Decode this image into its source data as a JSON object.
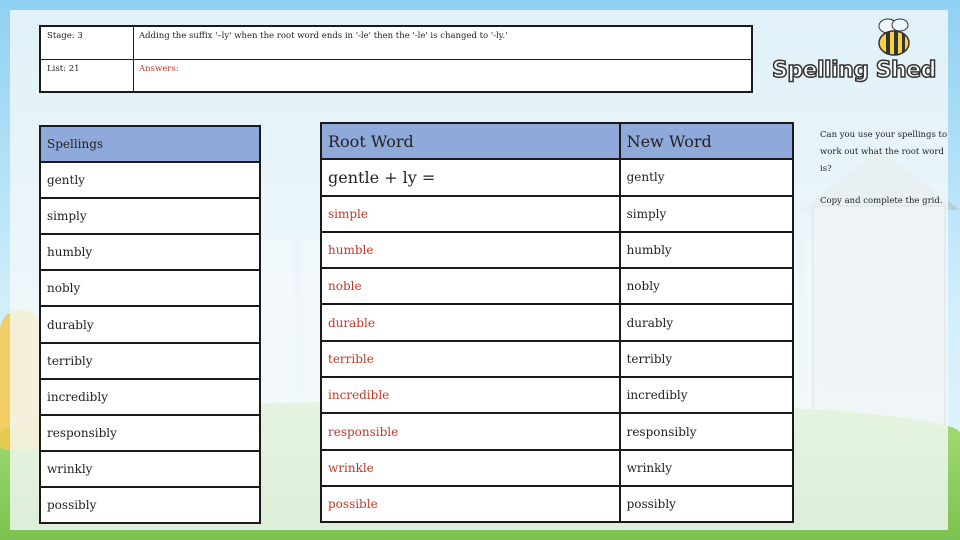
{
  "header": {
    "stage_label": "Stage: 3",
    "list_label": "List: 21",
    "rule_text": "Adding the suffix '–ly' when the root word ends in '-le' then the '-le' is changed to '-ly.'",
    "answers_label": "Answers:"
  },
  "logo": {
    "text": "Spelling Shed"
  },
  "sidebar": {
    "note1": "Can you use your spellings to work out what the root word is?",
    "note2": "Copy and complete the grid."
  },
  "spellings": {
    "header": "Spellings",
    "items": [
      "gently",
      "simply",
      "humbly",
      "nobly",
      "durably",
      "terribly",
      "incredibly",
      "responsibly",
      "wrinkly",
      "possibly"
    ]
  },
  "grid": {
    "root_header": "Root Word",
    "new_header": "New Word",
    "rows": [
      {
        "root": "gentle + ly =",
        "new": "gently"
      },
      {
        "root": "simple",
        "new": "simply"
      },
      {
        "root": "humble",
        "new": "humbly"
      },
      {
        "root": "noble",
        "new": "nobly"
      },
      {
        "root": "durable",
        "new": "durably"
      },
      {
        "root": "terrible",
        "new": "terribly"
      },
      {
        "root": "incredible",
        "new": "incredibly"
      },
      {
        "root": "responsible",
        "new": "responsibly"
      },
      {
        "root": "wrinkle",
        "new": "wrinkly"
      },
      {
        "root": "possible",
        "new": "possibly"
      }
    ]
  },
  "colors": {
    "header_fill": "#8fa9da",
    "answer_red": "#c0392b",
    "border": "#1a1a1a"
  }
}
